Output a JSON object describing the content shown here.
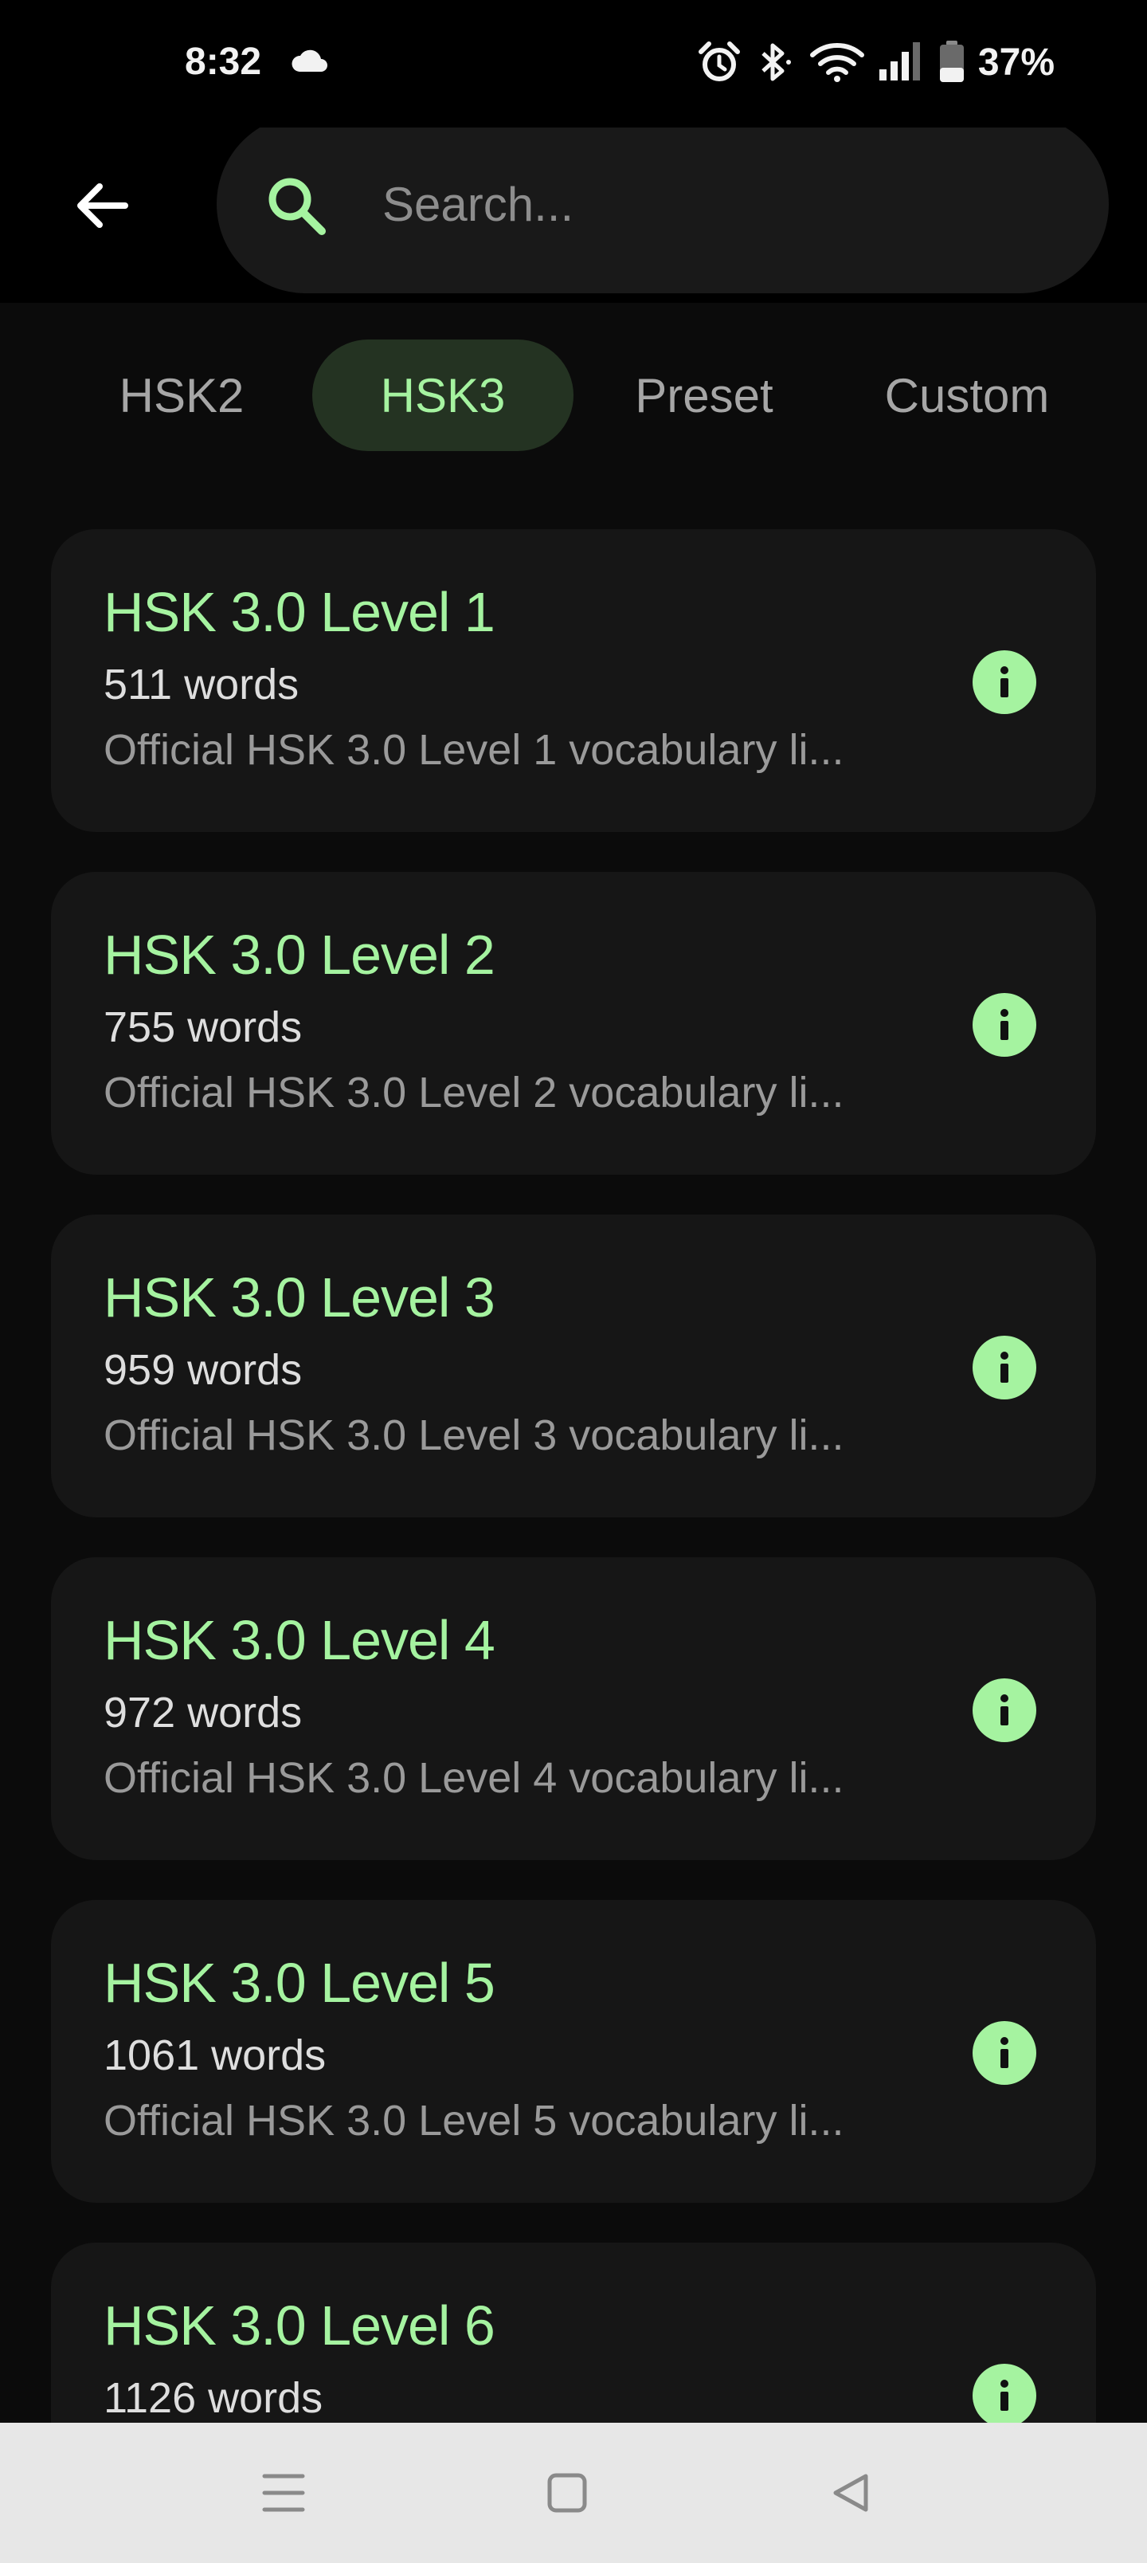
{
  "status_bar": {
    "time": "8:32",
    "battery": "37%",
    "icons": [
      "cloud-icon",
      "alarm-icon",
      "bluetooth-icon",
      "wifi-icon",
      "signal-icon",
      "battery-icon"
    ]
  },
  "search": {
    "placeholder": "Search...",
    "value": ""
  },
  "tabs": [
    {
      "label": "HSK2",
      "active": false
    },
    {
      "label": "HSK3",
      "active": true
    },
    {
      "label": "Preset",
      "active": false
    },
    {
      "label": "Custom",
      "active": false
    }
  ],
  "lists": [
    {
      "title": "HSK 3.0 Level 1",
      "count": "511 words",
      "description": "Official HSK 3.0 Level 1 vocabulary li..."
    },
    {
      "title": "HSK 3.0 Level 2",
      "count": "755 words",
      "description": "Official HSK 3.0 Level 2 vocabulary li..."
    },
    {
      "title": "HSK 3.0 Level 3",
      "count": "959 words",
      "description": "Official HSK 3.0 Level 3 vocabulary li..."
    },
    {
      "title": "HSK 3.0 Level 4",
      "count": "972 words",
      "description": "Official HSK 3.0 Level 4 vocabulary li..."
    },
    {
      "title": "HSK 3.0 Level 5",
      "count": "1061 words",
      "description": "Official HSK 3.0 Level 5 vocabulary li..."
    },
    {
      "title": "HSK 3.0 Level 6",
      "count": "1126 words",
      "description": ""
    }
  ],
  "colors": {
    "accent": "#a5f3a0",
    "background": "#0b0b0b",
    "card": "#161616",
    "active_tab_bg": "#243322"
  },
  "nav_bar": {
    "icons": [
      "menu-icon",
      "home-square-icon",
      "back-triangle-icon"
    ]
  }
}
